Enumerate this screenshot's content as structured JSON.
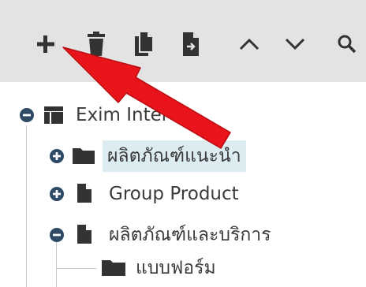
{
  "toolbar": {
    "buttons": [
      {
        "name": "add",
        "icon": "plus-icon"
      },
      {
        "name": "delete",
        "icon": "trash-icon"
      },
      {
        "name": "copy",
        "icon": "copy-icon"
      },
      {
        "name": "move",
        "icon": "file-move-icon"
      },
      {
        "name": "move-up",
        "icon": "chevron-up-icon"
      },
      {
        "name": "move-down",
        "icon": "chevron-down-icon"
      },
      {
        "name": "search",
        "icon": "search-icon"
      }
    ]
  },
  "tree": {
    "nodes": [
      {
        "label": "Exim Inter",
        "icon": "table-icon",
        "toggle": "collapse",
        "selected": false
      },
      {
        "label": "ผลิตภัณฑ์แนะนำ",
        "icon": "folder-icon",
        "toggle": "expand",
        "selected": true
      },
      {
        "label": "Group Product",
        "icon": "document-icon",
        "toggle": "expand",
        "selected": false
      },
      {
        "label": "ผลิตภัณฑ์และบริการ",
        "icon": "document-icon",
        "toggle": "collapse",
        "selected": false
      },
      {
        "label": "แบบฟอร์ม",
        "icon": "folder-icon",
        "toggle": "none",
        "selected": false
      }
    ]
  },
  "annotation": {
    "type": "red-arrow",
    "points_to": "add-button",
    "color": "#e8131b"
  },
  "colors": {
    "toolbar_bg": "#e3e3e3",
    "icon_dark": "#333333",
    "toggle_blue": "#2f4a66",
    "selected_bg": "#dcecf1",
    "arrow_red": "#e8131b"
  }
}
